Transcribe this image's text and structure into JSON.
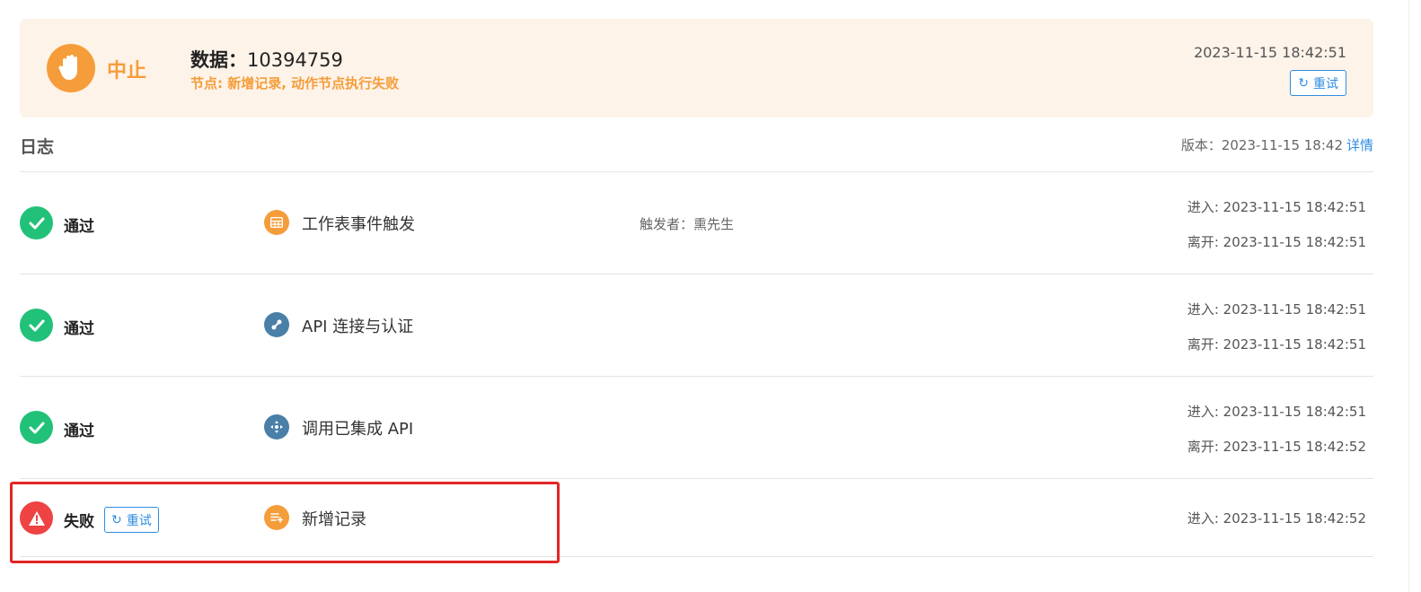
{
  "banner": {
    "status_label": "中止",
    "data_key": "数据：",
    "data_value": "10394759",
    "node_info": "节点: 新增记录, 动作节点执行失败",
    "timestamp": "2023-11-15 18:42:51",
    "retry_label": "重试",
    "status_color": "#f59d3a",
    "background": "#fef3e9"
  },
  "log": {
    "title": "日志",
    "version_text": "版本：2023-11-15 18:42",
    "details_link": "详情"
  },
  "rows": [
    {
      "status": "通过",
      "status_icon": "check-icon",
      "node_icon": "worksheet-icon",
      "node_name": "工作表事件触发",
      "trigger": "触发者：熏先生",
      "enter": "进入: 2023-11-15 18:42:51",
      "leave": "离开: 2023-11-15 18:42:51"
    },
    {
      "status": "通过",
      "status_icon": "check-icon",
      "node_icon": "api-connect-icon",
      "node_name": "API 连接与认证",
      "enter": "进入: 2023-11-15 18:42:51",
      "leave": "离开: 2023-11-15 18:42:51"
    },
    {
      "status": "通过",
      "status_icon": "check-icon",
      "node_icon": "api-call-icon",
      "node_name": "调用已集成 API",
      "enter": "进入: 2023-11-15 18:42:51",
      "leave": "离开: 2023-11-15 18:42:52"
    },
    {
      "status": "失败",
      "status_icon": "warning-icon",
      "retry_label": "重试",
      "node_icon": "add-record-icon",
      "node_name": "新增记录",
      "enter": "进入: 2023-11-15 18:42:52"
    }
  ],
  "colors": {
    "pass": "#22c17a",
    "fail": "#ef4242",
    "link": "#2f8de0",
    "highlight": "#e32626"
  }
}
